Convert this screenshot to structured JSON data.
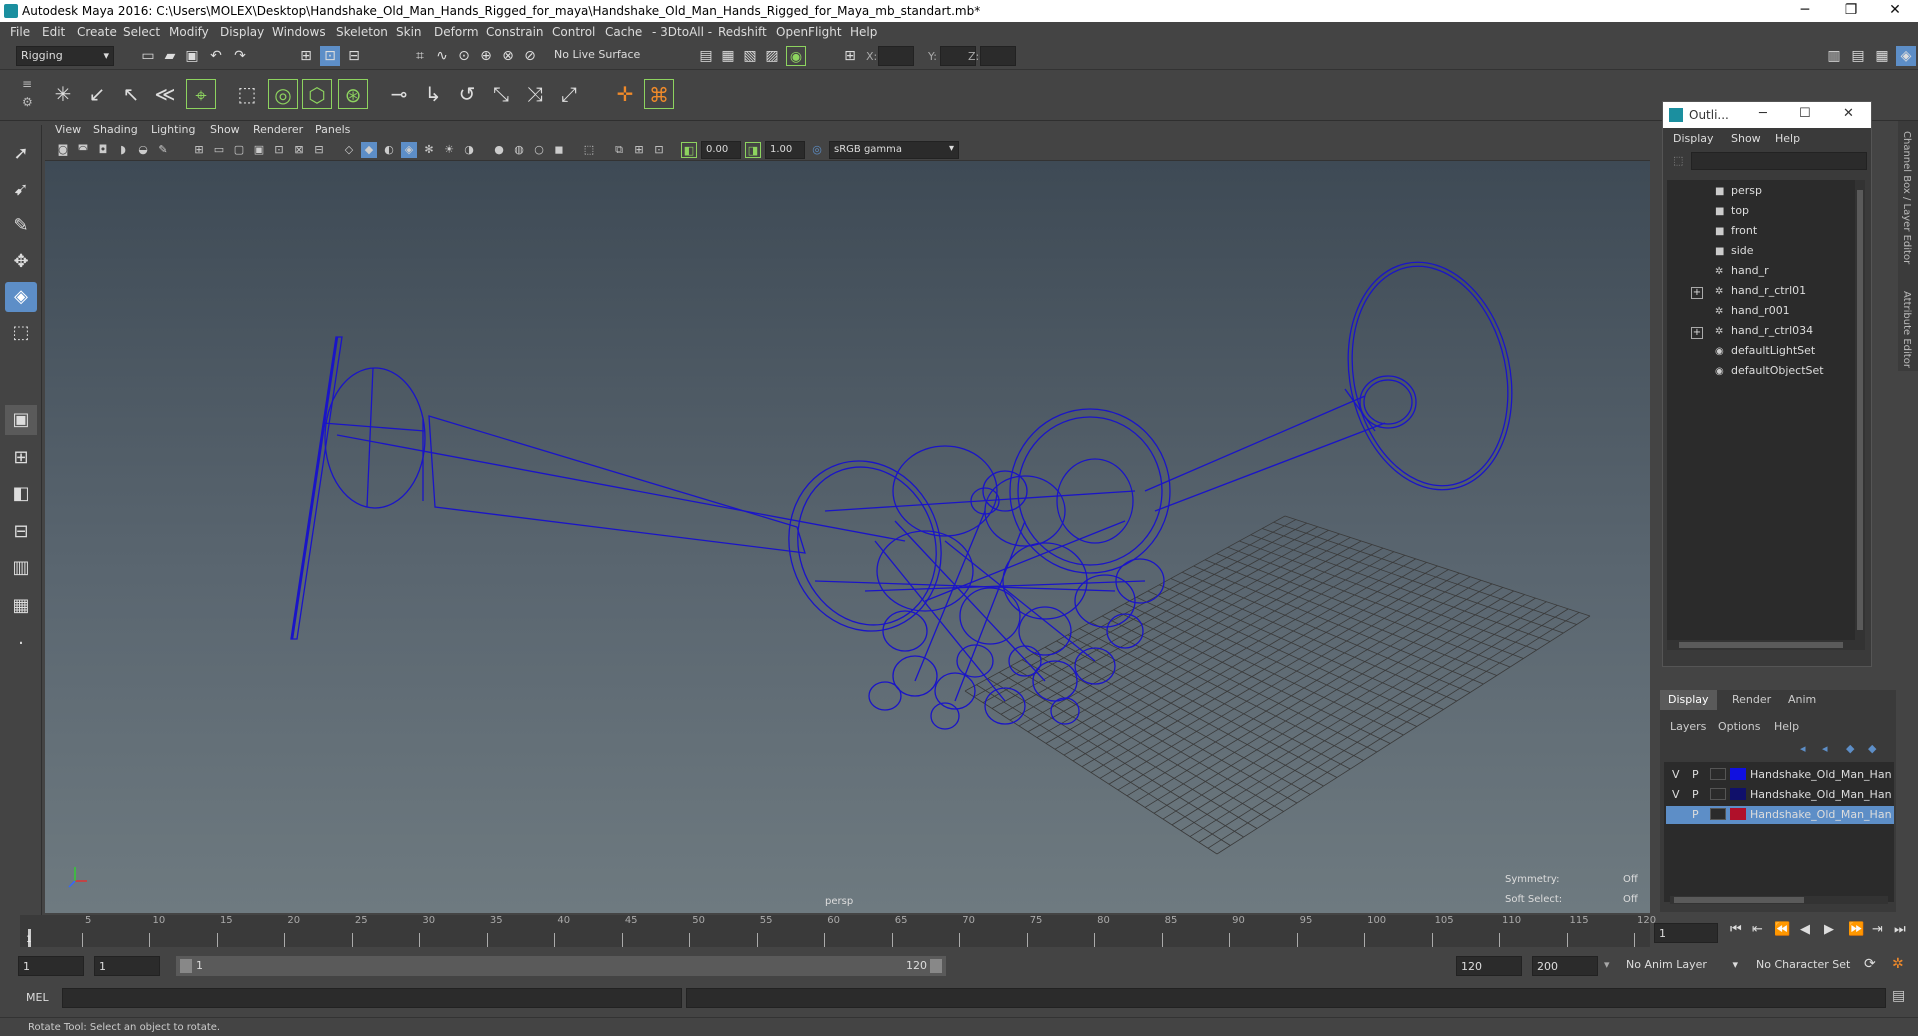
{
  "window": {
    "title": "Autodesk Maya 2016: C:\\Users\\MOLEX\\Desktop\\Handshake_Old_Man_Hands_Rigged_for_maya\\Handshake_Old_Man_Hands_Rigged_for_Maya_mb_standart.mb*",
    "minimize": "─",
    "restore": "❐",
    "close": "✕"
  },
  "menu": [
    "File",
    "Edit",
    "Create",
    "Select",
    "Modify",
    "Display",
    "Windows",
    "Skeleton",
    "Skin",
    "Deform",
    "Constrain",
    "Control",
    "Cache",
    "- 3DtoAll -",
    "Redshift",
    "OpenFlight",
    "Help"
  ],
  "status": {
    "mode": "Rigging",
    "live_surface": "No Live Surface",
    "x_label": "X:",
    "y_label": "Y:",
    "z_label": "Z:"
  },
  "viewport": {
    "menu": [
      "View",
      "Shading",
      "Lighting",
      "Show",
      "Renderer",
      "Panels"
    ],
    "exposure": "0.00",
    "gamma": "1.00",
    "color_space": "sRGB gamma",
    "camera_label": "persp",
    "symmetry_label": "Symmetry:",
    "symmetry_value": "Off",
    "soft_select_label": "Soft Select:",
    "soft_select_value": "Off",
    "wire_color": "#1a14c8",
    "grid_color": "#3a3a3a"
  },
  "outliner": {
    "title": "Outli...",
    "menu": [
      "Display",
      "Show",
      "Help"
    ],
    "items": [
      {
        "label": "persp",
        "icon": "camera-icon",
        "expandable": false
      },
      {
        "label": "top",
        "icon": "camera-icon",
        "expandable": false
      },
      {
        "label": "front",
        "icon": "camera-icon",
        "expandable": false
      },
      {
        "label": "side",
        "icon": "camera-icon",
        "expandable": false
      },
      {
        "label": "hand_r",
        "icon": "joint-icon",
        "expandable": false
      },
      {
        "label": "hand_r_ctrl01",
        "icon": "joint-icon",
        "expandable": true
      },
      {
        "label": "hand_r001",
        "icon": "joint-icon",
        "expandable": false
      },
      {
        "label": "hand_r_ctrl034",
        "icon": "joint-icon",
        "expandable": true
      },
      {
        "label": "defaultLightSet",
        "icon": "set-icon",
        "expandable": false
      },
      {
        "label": "defaultObjectSet",
        "icon": "set-icon",
        "expandable": false
      }
    ]
  },
  "side_tabs": [
    "Channel Box / Layer Editor",
    "Attribute Editor"
  ],
  "layers": {
    "tabs": [
      "Display",
      "Render",
      "Anim"
    ],
    "menu": [
      "Layers",
      "Options",
      "Help"
    ],
    "rows": [
      {
        "v": "V",
        "p": "P",
        "color": "#1010e0",
        "name": "Handshake_Old_Man_Han",
        "selected": false
      },
      {
        "v": "V",
        "p": "P",
        "color": "#10106a",
        "name": "Handshake_Old_Man_Han",
        "selected": false
      },
      {
        "v": "",
        "p": "P",
        "color": "#b0102a",
        "name": "Handshake_Old_Man_Han",
        "selected": true
      }
    ]
  },
  "timeline": {
    "ticks": [
      "5",
      "10",
      "15",
      "20",
      "25",
      "30",
      "35",
      "40",
      "45",
      "50",
      "55",
      "60",
      "65",
      "70",
      "75",
      "80",
      "85",
      "90",
      "95",
      "100",
      "105",
      "110",
      "115",
      "120"
    ],
    "current_frame": "1",
    "start_marker": "1"
  },
  "range": {
    "start": "1",
    "inner_start": "1",
    "slider_start": "1",
    "slider_end": "120",
    "end": "120",
    "max_end": "200",
    "anim_layer": "No Anim Layer",
    "character_set": "No Character Set"
  },
  "command": {
    "language": "MEL"
  },
  "help": "Rotate Tool: Select an object to rotate."
}
